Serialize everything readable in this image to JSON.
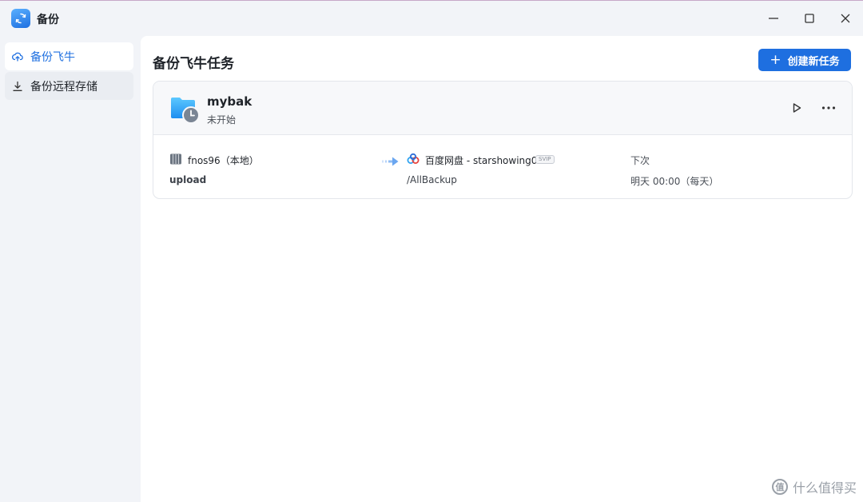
{
  "app": {
    "title": "备份",
    "icon": "backup-sync-icon"
  },
  "window_controls": {
    "minimize": "minimize-icon",
    "maximize": "maximize-icon",
    "close": "close-icon"
  },
  "sidebar": {
    "items": [
      {
        "label": "备份飞牛",
        "icon": "cloud-upload-icon",
        "active": true
      },
      {
        "label": "备份远程存储",
        "icon": "download-icon",
        "active": false
      }
    ]
  },
  "main": {
    "title": "备份飞牛任务",
    "create_button": "创建新任务"
  },
  "task": {
    "name": "mybak",
    "status": "未开始",
    "source": {
      "name": "fnos96（本地）",
      "path": "upload"
    },
    "destination": {
      "name": "百度网盘 - starshowing04",
      "badge": "SVIP",
      "path": "/AllBackup"
    },
    "schedule": {
      "label": "下次",
      "value": "明天 00:00（每天）"
    }
  },
  "watermark": "什么值得买",
  "colors": {
    "accent": "#1e6fe0",
    "sidebar_bg": "#f2f4f8",
    "card_head_bg": "#f7f8fa"
  }
}
